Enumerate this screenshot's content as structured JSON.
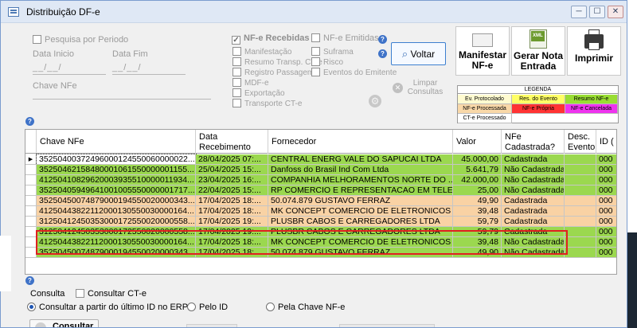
{
  "window": {
    "title": "Distribuição DF-e",
    "min": "─",
    "max": "☐",
    "close": "✕"
  },
  "filter": {
    "pesquisa_periodo": "Pesquisa por Periodo",
    "data_inicio_label": "Data Inicio",
    "data_fim_label": "Data Fim",
    "data_inicio_value": "__/__/",
    "data_fim_value": "__/__/",
    "chave_label": "Chave NFe"
  },
  "nfe_options": {
    "recebidas": "NF-e Recebidas",
    "emitidas": "NF-e Emitidas",
    "col1": [
      "Manifestação",
      "Resumo Transp. CT-e",
      "Registro Passagem",
      "MDF-e",
      "Exportação",
      "Transporte CT-e"
    ],
    "col2": [
      "Suframa",
      "Risco",
      "Eventos do Emitente"
    ]
  },
  "buttons": {
    "voltar": "Voltar",
    "limpar": "Limpar Consultas",
    "manifestar": "Manifestar NF-e",
    "gerar_nota": "Gerar Nota Entrada",
    "imprimir": "Imprimir",
    "xml_badge": "XML"
  },
  "legend": {
    "title": "LEGENDA",
    "items": [
      {
        "label": "Ev. Protocolado",
        "color": "#fffbd0"
      },
      {
        "label": "Res. do Evento",
        "color": "#ffff66"
      },
      {
        "label": "Resumo NF-e",
        "color": "#99dd33"
      },
      {
        "label": "NF-e Processada",
        "color": "#f9d8a8"
      },
      {
        "label": "NF-e Própria",
        "color": "#ff3333"
      },
      {
        "label": "NF-e Cancelada",
        "color": "#ee33ee"
      },
      {
        "label": "CT-e Processado",
        "color": "#ffffff"
      }
    ]
  },
  "grid": {
    "columns": [
      "Chave NFe",
      "Data Recebimento",
      "Fornecedor",
      "Valor",
      "NFe Cadastrada?",
      "Desc. Evento",
      "ID ("
    ],
    "rows": [
      {
        "chave": "35250400372496000124550060000022...",
        "data": "28/04/2025 07:...",
        "fornecedor": "CENTRAL ENERG VALE DO SAPUCAI LTDA",
        "valor": "45.000,00",
        "cad": "Cadastrada",
        "id": "000",
        "color": "#9bd84f",
        "selected": true
      },
      {
        "chave": "35250462158480001061550000001155...",
        "data": "25/04/2025 15:...",
        "fornecedor": "Danfoss do Brasil Ind Com Ltda",
        "valor": "5.641,79",
        "cad": "Não Cadastrada",
        "id": "000",
        "color": "#9bd84f"
      },
      {
        "chave": "41250410829620003935510000011934...",
        "data": "23/04/2025 16:...",
        "fornecedor": "COMPANHIA MELHORAMENTOS NORTE DO ...",
        "valor": "42.000,00",
        "cad": "Não Cadastrada",
        "id": "000",
        "color": "#9bd84f"
      },
      {
        "chave": "35250405949641001005550000001717...",
        "data": "22/04/2025 15:...",
        "fornecedor": "RP COMERCIO E REPRESENTACAO EM TELE...",
        "valor": "25,00",
        "cad": "Não Cadastrada",
        "id": "000",
        "color": "#9bd84f"
      },
      {
        "chave": "35250450074879000194550020000343...",
        "data": "17/04/2025 18:...",
        "fornecedor": "50.074.879 GUSTAVO FERRAZ",
        "valor": "49,90",
        "cad": "Cadastrada",
        "id": "000",
        "color": "#f9d2a4"
      },
      {
        "chave": "41250443822112000130550030000164...",
        "data": "17/04/2025 18:...",
        "fornecedor": "MK CONCEPT COMERCIO DE ELETRONICOS",
        "valor": "39,48",
        "cad": "Cadastrada",
        "id": "000",
        "color": "#f9d2a4"
      },
      {
        "chave": "31250412450353000172550020000558...",
        "data": "17/04/2025 19:...",
        "fornecedor": "PLUSBR CABOS E CARREGADORES LTDA",
        "valor": "59,79",
        "cad": "Cadastrada",
        "id": "000",
        "color": "#f9d2a4"
      },
      {
        "chave": "31250412450353000172550020000558...",
        "data": "17/04/2025 19:...",
        "fornecedor": "PLUSBR CABOS E CARREGADORES LTDA",
        "valor": "59,79",
        "cad": "Cadastrada",
        "id": "000",
        "color": "#9bd84f"
      },
      {
        "chave": "41250443822112000130550030000164...",
        "data": "17/04/2025 18:...",
        "fornecedor": "MK CONCEPT COMERCIO DE ELETRONICOS",
        "valor": "39,48",
        "cad": "Não Cadastrada",
        "id": "000",
        "color": "#9bd84f"
      },
      {
        "chave": "35250450074879000194550020000343...",
        "data": "17/04/2025 18:...",
        "fornecedor": "50.074.879 GUSTAVO FERRAZ",
        "valor": "49,90",
        "cad": "Não Cadastrada",
        "id": "000",
        "color": "#9bd84f"
      }
    ]
  },
  "consulta": {
    "label": "Consulta",
    "consultar_cte": "Consultar CT-e",
    "opt_ultimo_id": "Consultar a partir do último ID no ERP",
    "opt_pelo_id": "Pelo ID",
    "opt_pela_chave": "Pela Chave NF-e",
    "consultar_btn": "Consultar"
  }
}
